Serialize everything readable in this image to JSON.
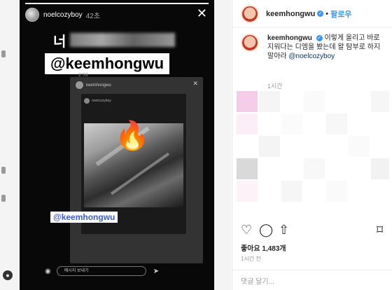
{
  "story": {
    "username": "noelcozyboy",
    "time_ago": "42초",
    "close_icon": "close-icon",
    "overlay_first_char": "너",
    "mention": "@keemhongwu",
    "small_time": "2:53",
    "nested_mention": "@keemhongwu",
    "message_placeholder": "메시지 보내기",
    "emoji": "🔥"
  },
  "post": {
    "username": "keemhongwu",
    "follow_label": "팔로우",
    "caption_username": "keemhongwu",
    "caption_text": "이렇게 올리고 바로 지워다는 디엠을 봤는데 왈 탐부로 하지 말아라",
    "caption_tag": "@noelcozyboy",
    "caption_time": "1시간",
    "likes": "좋아요 1,483개",
    "ago": "1시간 전",
    "comment_placeholder": "댓글 달기..."
  },
  "colors": {
    "link_blue": "#3897f0",
    "story_bg": "#080808",
    "mention_blue": "#3b5bd6"
  }
}
